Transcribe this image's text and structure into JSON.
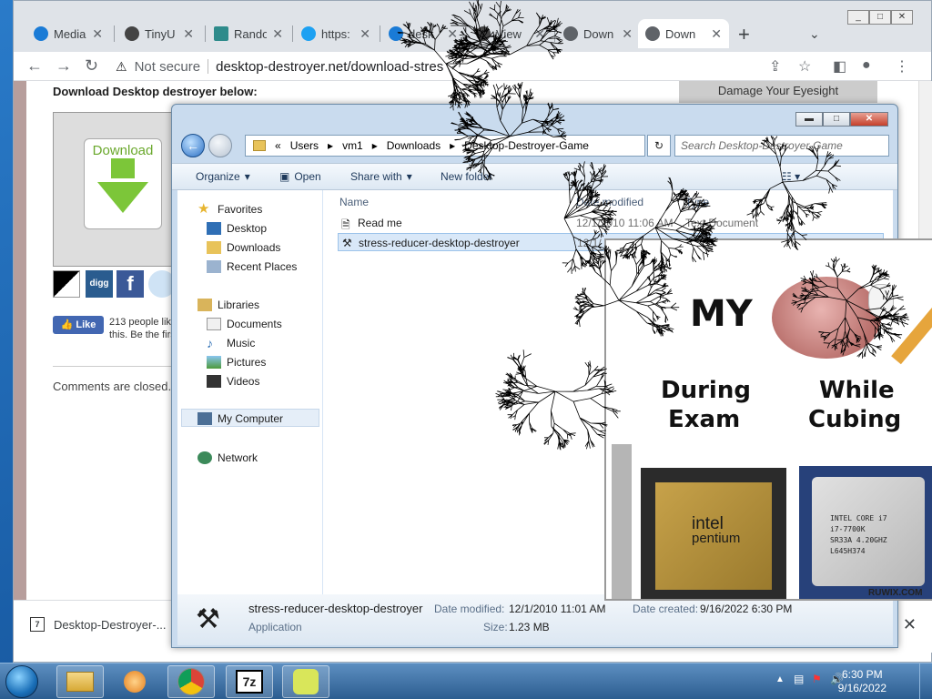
{
  "browser": {
    "tabs": [
      {
        "label": "Media",
        "favicon_color": "#1a7bd6"
      },
      {
        "label": "TinyU",
        "favicon_color": "#444444"
      },
      {
        "label": "Rando",
        "favicon_color": "#2e8b8b"
      },
      {
        "label": "https:",
        "favicon_color": "#1da1f2"
      },
      {
        "label": "desk",
        "favicon_color": "#1a7bd6"
      },
      {
        "label": "View",
        "favicon_color": "#444444"
      },
      {
        "label": "Down",
        "favicon_color": "#5f6368"
      },
      {
        "label": "Down",
        "favicon_color": "#5f6368"
      }
    ],
    "security_label": "Not secure",
    "url": "desktop-destroyer.net/download-stres"
  },
  "page": {
    "heading": "Download Desktop destroyer below:",
    "download_button": "Download",
    "share_icons": [
      "delicious",
      "digg",
      "facebook",
      "reddit"
    ],
    "like_button": "Like",
    "like_text": "213 people like this. Be the first of what your friends",
    "comments": "Comments are closed.",
    "side_widget": "Damage Your Eyesight"
  },
  "downloads_bar": {
    "file": "Desktop-Destroyer-..."
  },
  "explorer": {
    "breadcrumb": [
      "«",
      "Users",
      "vm1",
      "Downloads",
      "Desktop-Destroyer-Game"
    ],
    "search_placeholder": "Search Desktop-Destroyer-Game",
    "commands": {
      "organize": "Organize",
      "open": "Open",
      "share": "Share with",
      "newfolder": "New folder"
    },
    "nav": {
      "favorites": "Favorites",
      "desktop": "Desktop",
      "downloads": "Downloads",
      "recent": "Recent Places",
      "libraries": "Libraries",
      "documents": "Documents",
      "music": "Music",
      "pictures": "Pictures",
      "videos": "Videos",
      "mycomputer": "My Computer",
      "network": "Network"
    },
    "columns": {
      "name": "Name",
      "date": "Date modified",
      "type": "Type"
    },
    "files": [
      {
        "name": "Read me",
        "date": "12/1/2010 11:06 AM",
        "type": "Text Document"
      },
      {
        "name": "stress-reducer-desktop-destroyer",
        "date": "12/1/",
        "type": ""
      }
    ],
    "details": {
      "name": "stress-reducer-desktop-destroyer",
      "kind": "Application",
      "modified_label": "Date modified:",
      "modified": "12/1/2010 11:01 AM",
      "created_label": "Date created:",
      "created": "9/16/2022 6:30 PM",
      "size_label": "Size:",
      "size": "1.23 MB"
    }
  },
  "popup": {
    "word_my": "MY",
    "word_during": "During",
    "word_exam": "Exam",
    "word_while": "While",
    "word_cubing": "Cubing",
    "chip1_line1": "intel",
    "chip1_line2": "pentium",
    "chip2_lines": "INTEL CORE i7\ni7-7700K\nSR33A 4.20GHZ\nL645H374",
    "watermark": "RUWIX.COM"
  },
  "taskbar": {
    "time": "6:30 PM",
    "date": "9/16/2022"
  },
  "colors": {
    "accent": "#1a7bd6",
    "download_green": "#7cc639",
    "crack": "#000000"
  }
}
